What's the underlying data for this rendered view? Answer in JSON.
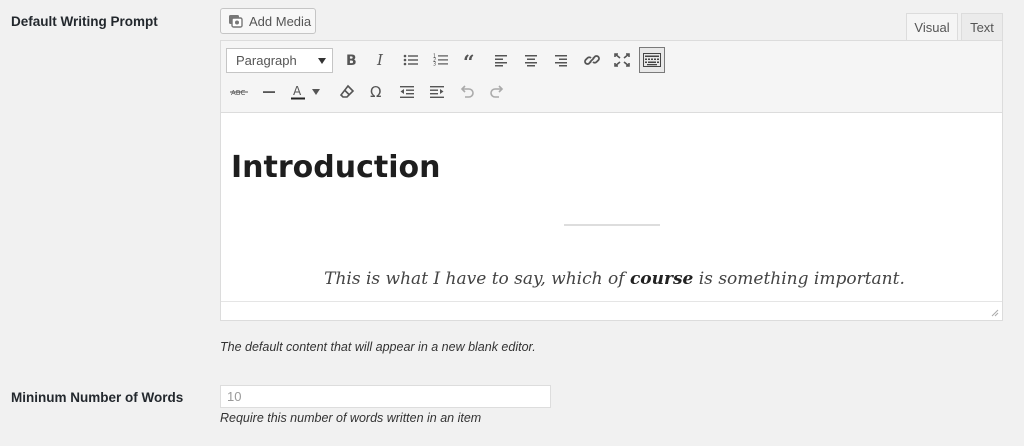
{
  "prompt_field": {
    "label": "Default Writing Prompt",
    "add_media": "Add Media",
    "tabs": {
      "visual": "Visual",
      "text": "Text"
    },
    "format_select": "Paragraph",
    "content": {
      "heading": "Introduction",
      "para_before": "This is what I have to say, which of ",
      "para_bold": "course",
      "para_after": " is something important."
    },
    "description": "The default content that will appear in a new blank editor."
  },
  "words_field": {
    "label": "Mininum Number of Words",
    "placeholder": "10",
    "description": "Require this number of words written in an item"
  },
  "toolbar_icons": [
    "bold-icon",
    "italic-icon",
    "bulleted-list-icon",
    "numbered-list-icon",
    "blockquote-icon",
    "align-left-icon",
    "align-center-icon",
    "align-right-icon",
    "link-icon",
    "fullscreen-icon",
    "toolbar-toggle-icon",
    "strikethrough-icon",
    "horizontal-line-icon",
    "text-color-icon",
    "clear-formatting-icon",
    "special-character-icon",
    "outdent-icon",
    "indent-icon",
    "undo-icon",
    "redo-icon"
  ],
  "colors": {
    "background": "#f1f1f1",
    "toolbar": "#f5f5f5",
    "border": "#dcdcdc"
  }
}
